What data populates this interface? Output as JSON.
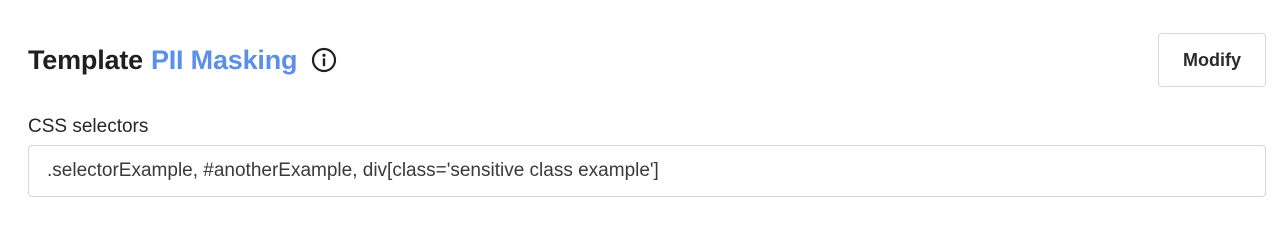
{
  "header": {
    "title_prefix": "Template",
    "title_link": "PII Masking",
    "info_icon": "info-circle-icon"
  },
  "actions": {
    "modify_label": "Modify"
  },
  "css_selectors": {
    "label": "CSS selectors",
    "value": ".selectorExample, #anotherExample, div[class='sensitive class example']"
  }
}
